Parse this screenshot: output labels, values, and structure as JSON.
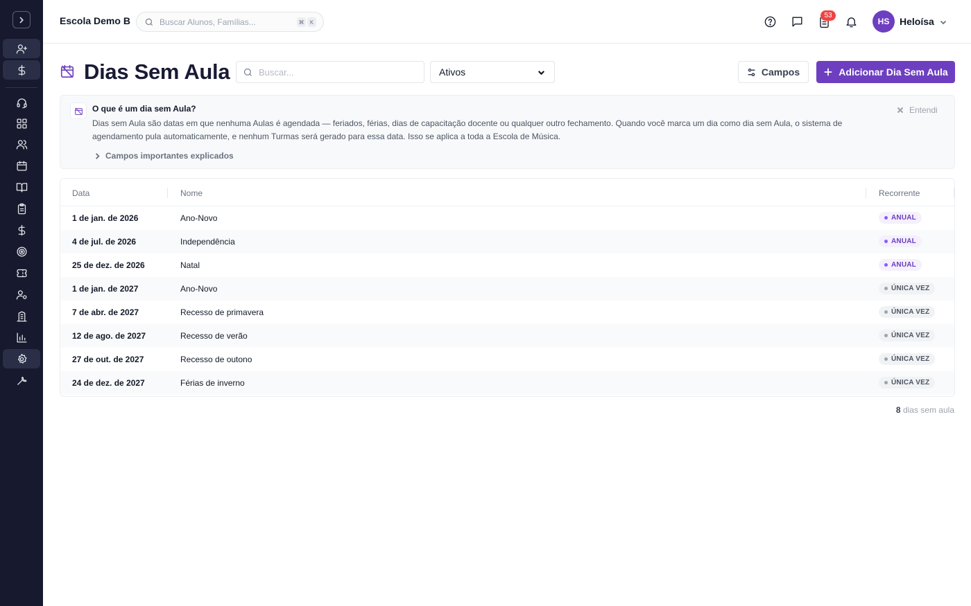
{
  "app": {
    "school_name": "Escola Demo B",
    "global_search_placeholder": "Buscar Alunos, Famílias...",
    "shortcut_keys": [
      "⌘",
      "K"
    ],
    "task_badge_count": "53",
    "user": {
      "initials": "HS",
      "name": "Heloísa"
    }
  },
  "sidebar": {
    "items": [
      {
        "icon": "user-plus-icon",
        "active": true
      },
      {
        "icon": "dollar-icon",
        "active": true
      },
      {
        "icon": "headset-icon"
      },
      {
        "icon": "grid-icon"
      },
      {
        "icon": "users-icon"
      },
      {
        "icon": "calendar-icon"
      },
      {
        "icon": "book-icon"
      },
      {
        "icon": "clipboard-icon"
      },
      {
        "icon": "dollar-icon"
      },
      {
        "icon": "target-icon"
      },
      {
        "icon": "ticket-icon"
      },
      {
        "icon": "user-cog-icon"
      },
      {
        "icon": "building-icon"
      },
      {
        "icon": "bar-chart-icon"
      },
      {
        "icon": "settings-icon",
        "active": true
      },
      {
        "icon": "wrench-icon"
      }
    ]
  },
  "page": {
    "title": "Dias Sem Aula",
    "search_placeholder": "Buscar...",
    "status_filter": "Ativos",
    "fields_button": "Campos",
    "add_button": "Adicionar Dia Sem Aula"
  },
  "info": {
    "title": "O que é um dia sem Aula?",
    "text": "Dias sem Aula são datas em que nenhuma Aulas é agendada — feriados, férias, dias de capacitação docente ou qualquer outro fechamento. Quando você marca um dia como dia sem Aula, o sistema de agendamento pula automaticamente, e nenhum Turmas será gerado para essa data. Isso se aplica a toda a Escola de Música.",
    "expand_label": "Campos importantes explicados",
    "dismiss_label": "Entendi"
  },
  "table": {
    "columns": [
      "Data",
      "Nome",
      "Recorrente"
    ],
    "rows": [
      {
        "date": "1 de jan. de 2026",
        "name": "Ano-Novo",
        "recurrence": "ANUAL",
        "type": "annual"
      },
      {
        "date": "4 de jul. de 2026",
        "name": "Independência",
        "recurrence": "ANUAL",
        "type": "annual"
      },
      {
        "date": "25 de dez. de 2026",
        "name": "Natal",
        "recurrence": "ANUAL",
        "type": "annual"
      },
      {
        "date": "1 de jan. de 2027",
        "name": "Ano-Novo",
        "recurrence": "ÚNICA VEZ",
        "type": "once"
      },
      {
        "date": "7 de abr. de 2027",
        "name": "Recesso de primavera",
        "recurrence": "ÚNICA VEZ",
        "type": "once"
      },
      {
        "date": "12 de ago. de 2027",
        "name": "Recesso de verão",
        "recurrence": "ÚNICA VEZ",
        "type": "once"
      },
      {
        "date": "27 de out. de 2027",
        "name": "Recesso de outono",
        "recurrence": "ÚNICA VEZ",
        "type": "once"
      },
      {
        "date": "24 de dez. de 2027",
        "name": "Férias de inverno",
        "recurrence": "ÚNICA VEZ",
        "type": "once"
      }
    ]
  },
  "footer": {
    "count": "8",
    "count_label": "dias sem aula"
  },
  "colors": {
    "accent": "#6d3fc0",
    "sidebar_bg": "#171a2e",
    "badge": "#ef4444"
  }
}
